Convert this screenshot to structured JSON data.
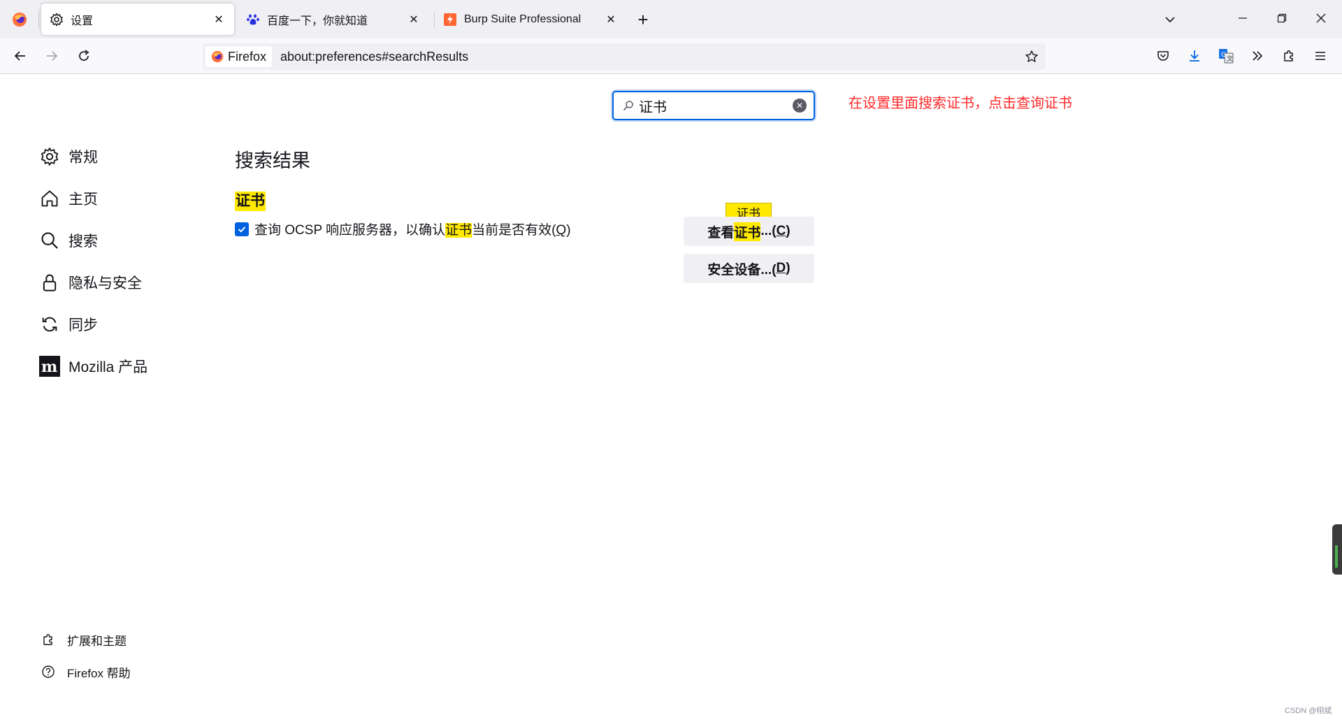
{
  "tabs": [
    {
      "title": "设置",
      "icon": "gear-icon",
      "active": true
    },
    {
      "title": "百度一下，你就知道",
      "icon": "baidu-paw-icon",
      "active": false
    },
    {
      "title": "Burp Suite Professional",
      "icon": "burp-logo-icon",
      "active": false
    }
  ],
  "navbar": {
    "identity_label": "Firefox",
    "url": "about:preferences#searchResults"
  },
  "search": {
    "value": "证书"
  },
  "annotation": "在设置里面搜索证书，点击查询证书",
  "sidebar": {
    "categories": [
      {
        "label": "常规",
        "icon": "gear-icon"
      },
      {
        "label": "主页",
        "icon": "home-icon"
      },
      {
        "label": "搜索",
        "icon": "search-icon"
      },
      {
        "label": "隐私与安全",
        "icon": "lock-icon"
      },
      {
        "label": "同步",
        "icon": "sync-icon"
      },
      {
        "label": "Mozilla 产品",
        "icon": "mozilla-icon"
      }
    ],
    "footer": [
      {
        "label": "扩展和主题",
        "icon": "puzzle-icon"
      },
      {
        "label": "Firefox 帮助",
        "icon": "help-icon"
      }
    ]
  },
  "main": {
    "heading": "搜索结果",
    "group_title": "证书",
    "ocsp": {
      "checked": true,
      "prefix": "查询 OCSP 响应服务器，以确认",
      "highlight": "证书",
      "suffix": "当前是否有效(",
      "accesskey": "Q",
      "close": ")"
    },
    "view_certs": {
      "prefix": "查看",
      "highlight": "证书",
      "suffix": "...(",
      "accesskey": "C",
      "close": ")"
    },
    "security_devices": {
      "prefix": "安全设备...(",
      "accesskey": "D",
      "close": ")"
    },
    "tooltip": "证书"
  },
  "watermark": "CSDN @栩斌",
  "colors": {
    "accent": "#0061e0",
    "highlight": "#ffe900",
    "annotation": "#ff2a2a"
  }
}
